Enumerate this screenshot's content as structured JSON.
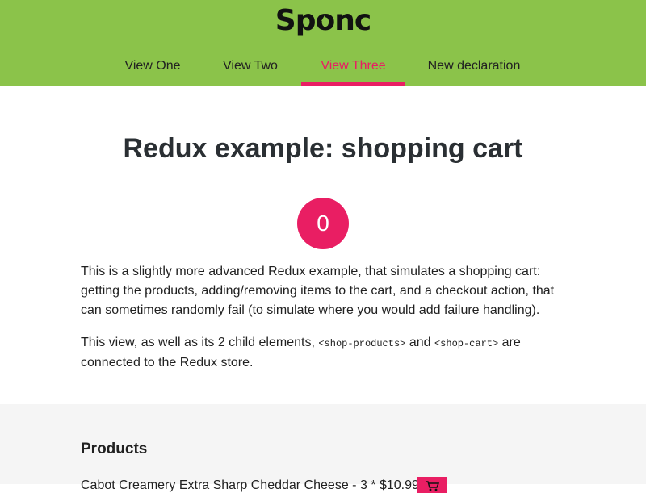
{
  "header": {
    "logo": "Sponc",
    "nav": [
      {
        "label": "View One",
        "active": false
      },
      {
        "label": "View Two",
        "active": false
      },
      {
        "label": "View Three",
        "active": true
      },
      {
        "label": "New declaration",
        "active": false
      }
    ]
  },
  "main": {
    "title": "Redux example: shopping cart",
    "cart_count": "0",
    "paragraph1": "This is a slightly more advanced Redux example, that simulates a shopping cart: getting the products, adding/removing items to the cart, and a checkout action, that can sometimes randomly fail (to simulate where you would add failure handling).",
    "paragraph2_before": "This view, as well as its 2 child elements, ",
    "paragraph2_code1": "<shop-products>",
    "paragraph2_and": " and ",
    "paragraph2_code2": "<shop-cart>",
    "paragraph2_after": " are connected to the Redux store."
  },
  "products_section": {
    "title": "Products",
    "first_item": "Cabot Creamery Extra Sharp Cheddar Cheese - 3 * $10.99"
  },
  "colors": {
    "header_bg": "#8bc34a",
    "accent": "#e91e63"
  }
}
